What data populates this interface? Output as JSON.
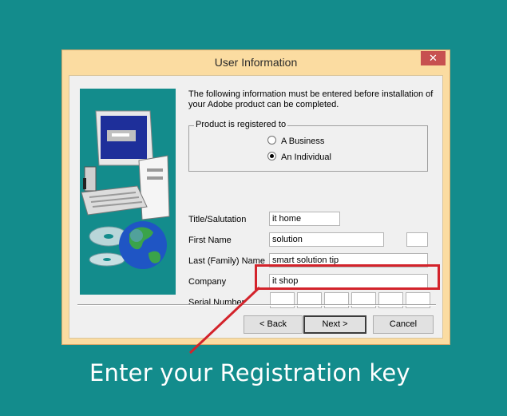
{
  "window": {
    "title": "User Information",
    "close_glyph": "✕"
  },
  "intro_text": "The following information must be entered before installation of your Adobe product can be completed.",
  "registration": {
    "legend": "Product is registered to",
    "options": [
      {
        "label": "A Business",
        "selected": false
      },
      {
        "label": "An Individual",
        "selected": true
      }
    ]
  },
  "fields": {
    "title": {
      "label": "Title/Salutation",
      "value": "it home"
    },
    "first_name": {
      "label": "First Name",
      "value": "solution",
      "initial": ""
    },
    "last_name": {
      "label": "Last (Family) Name",
      "value": "smart solution tip"
    },
    "company": {
      "label": "Company",
      "value": "it shop"
    },
    "serial": {
      "label": "Serial Number",
      "segments": [
        "",
        "",
        "",
        "",
        "",
        ""
      ]
    }
  },
  "buttons": {
    "back": "< Back",
    "next": "Next >",
    "cancel": "Cancel"
  },
  "annotation": {
    "caption": "Enter your Registration key",
    "highlight_color": "#d3232b"
  },
  "colors": {
    "background": "#138c8c",
    "window_frame": "#fbdca1",
    "dialog": "#f0f0f0"
  },
  "icons": [
    "computer-icon",
    "cd-icon",
    "globe-icon",
    "close-icon"
  ]
}
